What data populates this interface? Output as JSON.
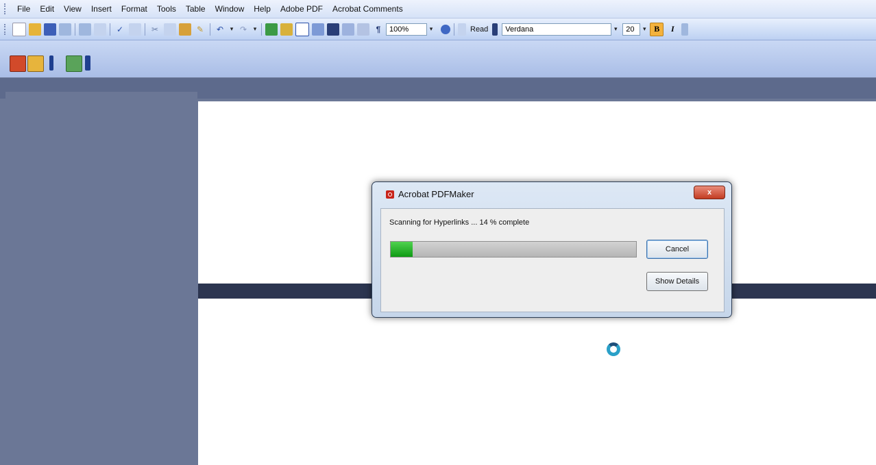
{
  "menubar": {
    "items": [
      "File",
      "Edit",
      "View",
      "Insert",
      "Format",
      "Tools",
      "Table",
      "Window",
      "Help",
      "Adobe PDF",
      "Acrobat Comments"
    ]
  },
  "toolbar": {
    "zoom": "100%",
    "read_label": "Read",
    "font": "Verdana",
    "font_size": "20",
    "bold_label": "B",
    "italic_label": "I"
  },
  "dialog": {
    "title": "Acrobat PDFMaker",
    "status": "Scanning for Hyperlinks ... 14 % complete",
    "progress": 0.09,
    "cancel_label": "Cancel",
    "details_label": "Show Details",
    "close_label": "x"
  }
}
